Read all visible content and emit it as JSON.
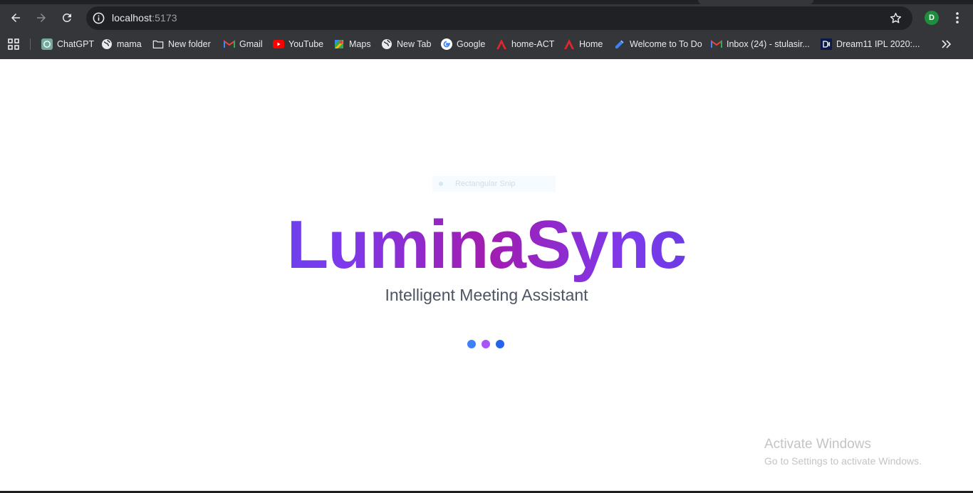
{
  "browser": {
    "url_host": "localhost",
    "url_port": ":5173",
    "profile_initial": "D",
    "bookmarks": [
      {
        "label": "ChatGPT",
        "icon": "chatgpt-icon"
      },
      {
        "label": "mama",
        "icon": "globe-icon"
      },
      {
        "label": "New folder",
        "icon": "folder-icon"
      },
      {
        "label": "Gmail",
        "icon": "gmail-icon"
      },
      {
        "label": "YouTube",
        "icon": "youtube-icon"
      },
      {
        "label": "Maps",
        "icon": "maps-icon"
      },
      {
        "label": "New Tab",
        "icon": "globe-icon"
      },
      {
        "label": "Google",
        "icon": "google-icon"
      },
      {
        "label": "home-ACT",
        "icon": "act-icon"
      },
      {
        "label": "Home",
        "icon": "act-icon"
      },
      {
        "label": "Welcome to To Do",
        "icon": "todo-icon"
      },
      {
        "label": "Inbox (24) - stulasir...",
        "icon": "gmail-icon"
      },
      {
        "label": "Dream11 IPL 2020:...",
        "icon": "dream11-icon"
      }
    ]
  },
  "overlay": {
    "snip_label": "Rectangular Snip"
  },
  "splash": {
    "brand": "LuminaSync",
    "subtitle": "Intelligent Meeting Assistant",
    "loader_colors": [
      "#3b82f6",
      "#a855f7",
      "#2563eb"
    ]
  },
  "watermark": {
    "line1": "Activate Windows",
    "line2": "Go to Settings to activate Windows."
  }
}
